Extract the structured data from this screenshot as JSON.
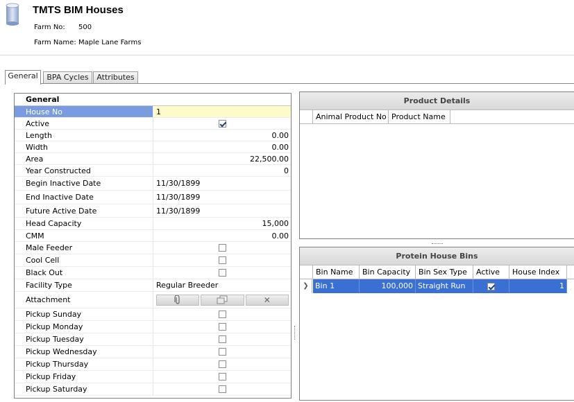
{
  "header": {
    "title": "TMTS BIM Houses",
    "farm_no_label": "Farm No:",
    "farm_no": "500",
    "farm_name_label": "Farm Name:",
    "farm_name": "Maple Lane Farms"
  },
  "tabs": [
    {
      "label": "General",
      "active": true
    },
    {
      "label": "BPA Cycles",
      "active": false
    },
    {
      "label": "Attributes",
      "active": false
    }
  ],
  "general": {
    "title": "General",
    "rows": [
      {
        "label": "House No",
        "value": "1"
      },
      {
        "label": "Active",
        "checked": true
      },
      {
        "label": "Length",
        "value": "0.00"
      },
      {
        "label": "Width",
        "value": "0.00"
      },
      {
        "label": "Area",
        "value": "22,500.00"
      },
      {
        "label": "Year Constructed",
        "value": "0"
      },
      {
        "label": "Begin Inactive Date",
        "value": "11/30/1899"
      },
      {
        "label": "End Inactive Date",
        "value": "11/30/1899"
      },
      {
        "label": "Future Active Date",
        "value": "11/30/1899"
      },
      {
        "label": "Head Capacity",
        "value": "15,000"
      },
      {
        "label": "CMM",
        "value": "0.00"
      },
      {
        "label": "Male Feeder",
        "checked": false
      },
      {
        "label": "Cool Cell",
        "checked": false
      },
      {
        "label": "Black Out",
        "checked": false
      },
      {
        "label": "Facility Type",
        "value": "Regular Breeder"
      },
      {
        "label": "Attachment"
      },
      {
        "label": "Pickup Sunday",
        "checked": false
      },
      {
        "label": "Pickup Monday",
        "checked": false
      },
      {
        "label": "Pickup Tuesday",
        "checked": false
      },
      {
        "label": "Pickup Wednesday",
        "checked": false
      },
      {
        "label": "Pickup Thursday",
        "checked": false
      },
      {
        "label": "Pickup Friday",
        "checked": false
      },
      {
        "label": "Pickup Saturday",
        "checked": false
      }
    ]
  },
  "product_details": {
    "title": "Product Details",
    "columns": [
      "Animal Product No",
      "Product Name"
    ]
  },
  "protein_bins": {
    "title": "Protein House Bins",
    "columns": [
      "Bin Name",
      "Bin Capacity",
      "Bin Sex Type",
      "Active",
      "House Index"
    ],
    "rows": [
      {
        "bin_name": "Bin 1",
        "bin_capacity": "100,000",
        "bin_sex_type": "Straight Run",
        "active": true,
        "house_index": "1"
      }
    ]
  }
}
